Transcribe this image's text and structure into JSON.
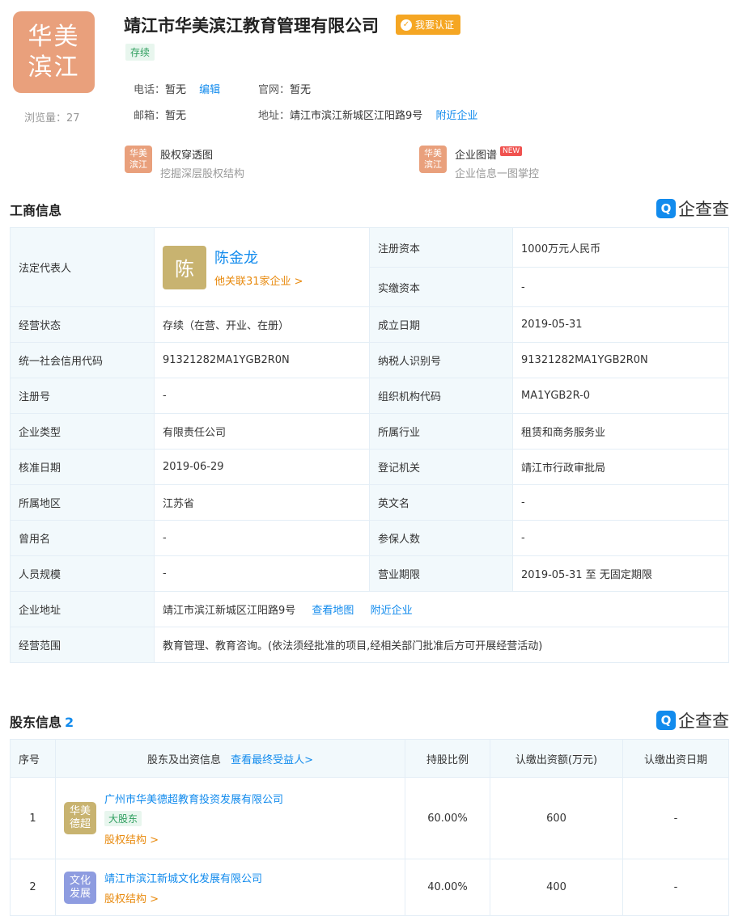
{
  "header": {
    "logo_line1": "华美",
    "logo_line2": "滨江",
    "views_label": "浏览量：27",
    "company_name": "靖江市华美滨江教育管理有限公司",
    "cert_label": "我要认证",
    "status": "存续",
    "phone_label": "电话：",
    "phone_value": "暂无",
    "edit_label": "编辑",
    "website_label": "官网：",
    "website_value": "暂无",
    "email_label": "邮箱：",
    "email_value": "暂无",
    "address_label": "地址：",
    "address_value": "靖江市滨江新城区江阳路9号",
    "nearby_label": "附近企业"
  },
  "features": [
    {
      "icon_line1": "华美",
      "icon_line2": "滨江",
      "title": "股权穿透图",
      "desc": "挖掘深层股权结构",
      "badge": ""
    },
    {
      "icon_line1": "华美",
      "icon_line2": "滨江",
      "title": "企业图谱",
      "desc": "企业信息一图掌控",
      "badge": "NEW"
    }
  ],
  "brand": {
    "mark": "Q",
    "name": "企查查",
    "color": "#128bed"
  },
  "business": {
    "title": "工商信息",
    "legal_rep_label": "法定代表人",
    "legal_rep_avatar": "陈",
    "legal_rep_name": "陈金龙",
    "legal_rep_related": "他关联31家企业 >",
    "reg_capital_label": "注册资本",
    "reg_capital_value": "1000万元人民币",
    "paid_capital_label": "实缴资本",
    "paid_capital_value": "-",
    "rows": [
      {
        "k1": "经营状态",
        "v1": "存续（在营、开业、在册）",
        "k2": "成立日期",
        "v2": "2019-05-31"
      },
      {
        "k1": "统一社会信用代码",
        "v1": "91321282MA1YGB2R0N",
        "k2": "纳税人识别号",
        "v2": "91321282MA1YGB2R0N"
      },
      {
        "k1": "注册号",
        "v1": "-",
        "k2": "组织机构代码",
        "v2": "MA1YGB2R-0"
      },
      {
        "k1": "企业类型",
        "v1": "有限责任公司",
        "k2": "所属行业",
        "v2": "租赁和商务服务业"
      },
      {
        "k1": "核准日期",
        "v1": "2019-06-29",
        "k2": "登记机关",
        "v2": "靖江市行政审批局"
      },
      {
        "k1": "所属地区",
        "v1": "江苏省",
        "k2": "英文名",
        "v2": "-"
      },
      {
        "k1": "曾用名",
        "v1": "-",
        "k2": "参保人数",
        "v2": "-"
      },
      {
        "k1": "人员规模",
        "v1": "-",
        "k2": "营业期限",
        "v2": "2019-05-31 至 无固定期限"
      }
    ],
    "address_label": "企业地址",
    "address_value": "靖江市滨江新城区江阳路9号",
    "view_map": "查看地图",
    "nearby": "附近企业",
    "scope_label": "经营范围",
    "scope_value": "教育管理、教育咨询。(依法须经批准的项目,经相关部门批准后方可开展经营活动)"
  },
  "shareholders": {
    "title": "股东信息",
    "count": "2",
    "headers": {
      "index": "序号",
      "holder": "股东及出资信息",
      "ubo_link": "查看最终受益人>",
      "ratio": "持股比例",
      "amount": "认缴出资额(万元)",
      "date": "认缴出资日期"
    },
    "rows": [
      {
        "index": "1",
        "icon_line1": "华美",
        "icon_line2": "德超",
        "icon_color": "#c8b370",
        "name": "广州市华美德超教育投资发展有限公司",
        "tag": "大股东",
        "equity": "股权结构 >",
        "ratio": "60.00%",
        "amount": "600",
        "date": "-"
      },
      {
        "index": "2",
        "icon_line1": "文化",
        "icon_line2": "发展",
        "icon_color": "#8e9ce0",
        "name": "靖江市滨江新城文化发展有限公司",
        "tag": "",
        "equity": "股权结构 >",
        "ratio": "40.00%",
        "amount": "400",
        "date": "-"
      }
    ]
  }
}
